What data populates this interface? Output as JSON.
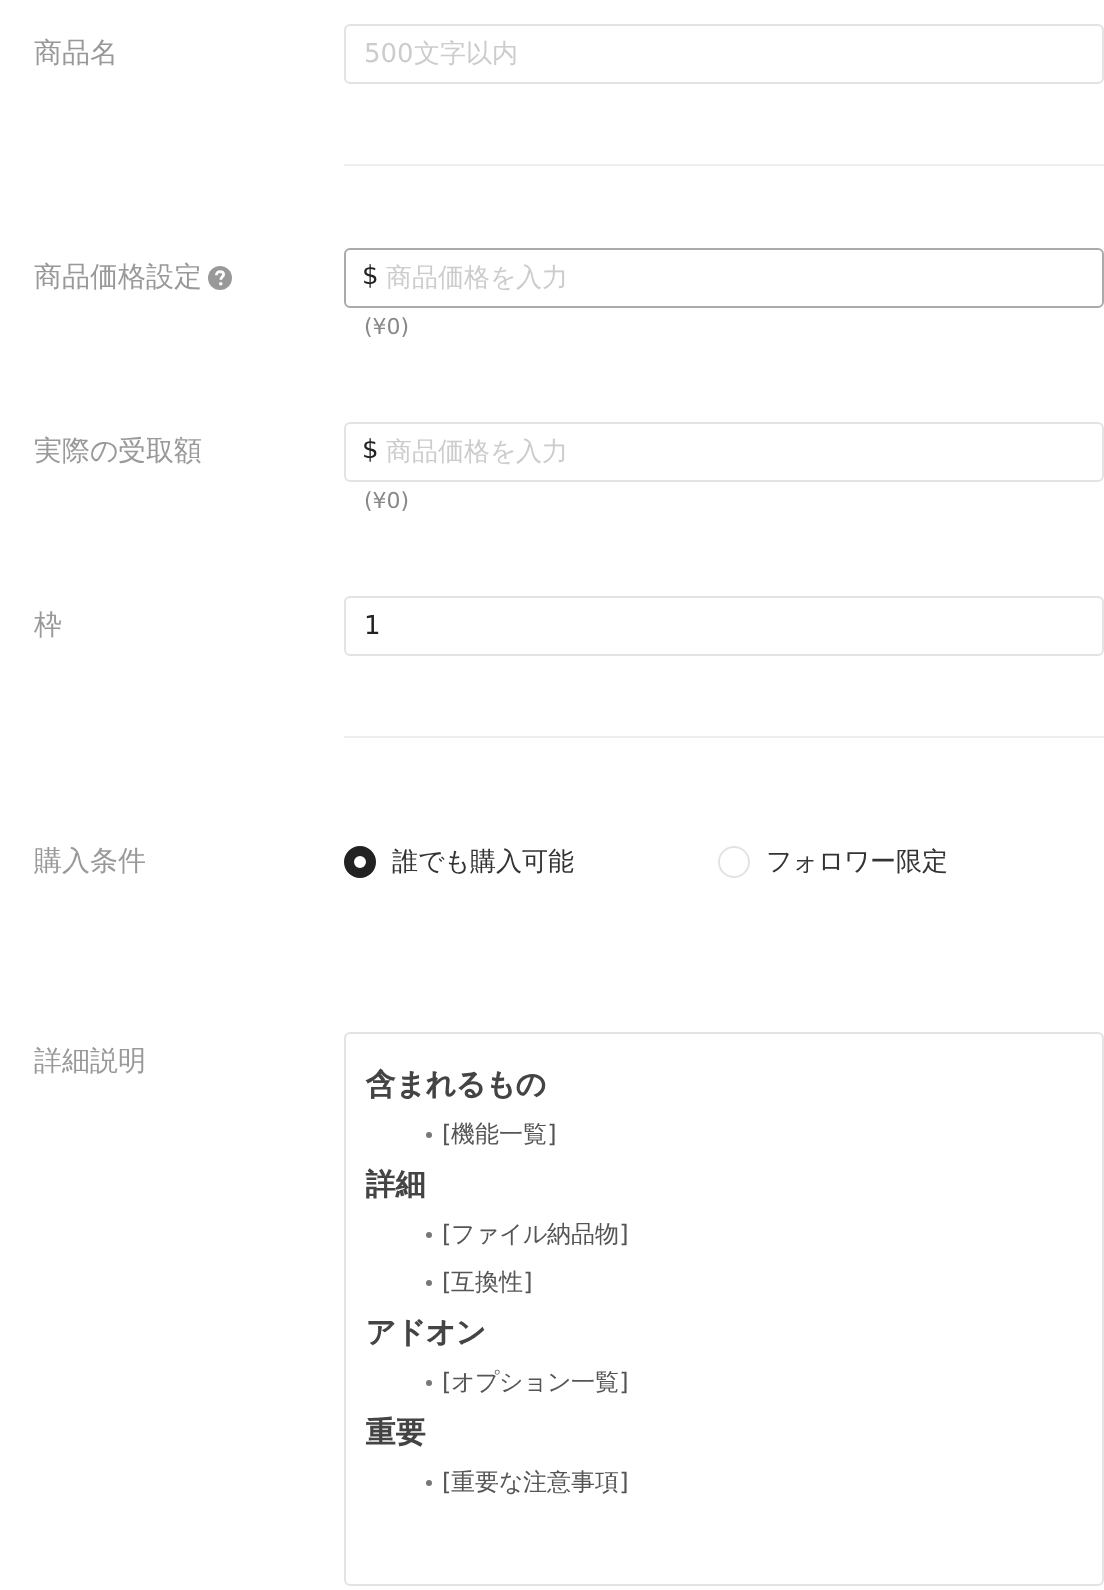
{
  "form": [
    {
      "kind": "text",
      "label": "商品名",
      "placeholder": "500文字以内",
      "divider_after": true
    },
    {
      "kind": "price",
      "label": "商品価格設定",
      "help": true,
      "prefix": "$",
      "placeholder": "商品価格を入力",
      "focused": true,
      "note": "(¥0)"
    },
    {
      "kind": "price",
      "label": "実際の受取額",
      "prefix": "$",
      "placeholder": "商品価格を入力",
      "focused": false,
      "note": "(¥0)"
    },
    {
      "kind": "text",
      "label": "枠",
      "value": "1",
      "divider_after": true
    },
    {
      "kind": "radio",
      "label": "購入条件",
      "options": [
        {
          "label": "誰でも購入可能",
          "selected": true
        },
        {
          "label": "フォロワー限定",
          "selected": false
        }
      ]
    },
    {
      "kind": "richtext",
      "label": "詳細説明",
      "blocks": [
        {
          "kind": "heading",
          "text": "含まれるもの"
        },
        {
          "kind": "bullet",
          "text": "[機能一覧]"
        },
        {
          "kind": "heading",
          "text": "詳細"
        },
        {
          "kind": "bullet",
          "text": "[ファイル納品物]"
        },
        {
          "kind": "bullet",
          "text": "[互換性]"
        },
        {
          "kind": "heading",
          "text": "アドオン"
        },
        {
          "kind": "bullet",
          "text": "[オプション一覧]"
        },
        {
          "kind": "heading",
          "text": "重要"
        },
        {
          "kind": "bullet",
          "text": "[重要な注意事項]"
        }
      ]
    }
  ]
}
